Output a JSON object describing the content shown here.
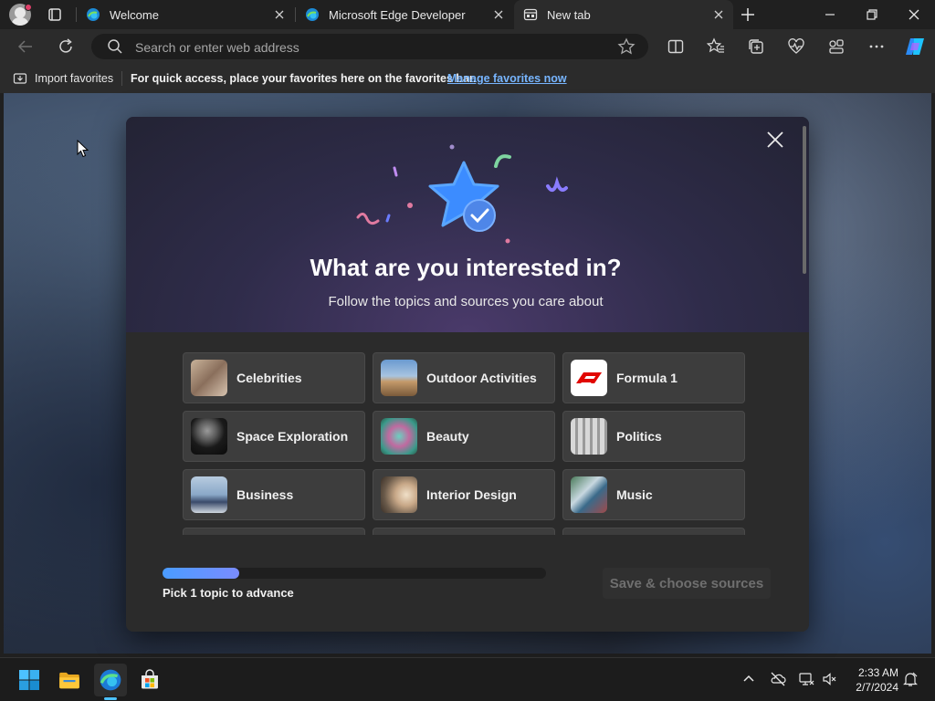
{
  "tabs": [
    {
      "label": "Welcome",
      "active": false
    },
    {
      "label": "Microsoft Edge Developer",
      "active": false
    },
    {
      "label": "New tab",
      "active": true
    }
  ],
  "address": {
    "placeholder": "Search or enter web address"
  },
  "favorites_bar": {
    "import_label": "Import favorites",
    "message": "For quick access, place your favorites here on the favorites bar.",
    "link": "Manage favorites now"
  },
  "modal": {
    "title": "What are you interested in?",
    "subtitle": "Follow the topics and sources you care about",
    "topics": [
      {
        "label": "Celebrities",
        "thumb": "celebrities"
      },
      {
        "label": "Outdoor Activities",
        "thumb": "outdoor"
      },
      {
        "label": "Formula 1",
        "thumb": "f1"
      },
      {
        "label": "Space Exploration",
        "thumb": "space"
      },
      {
        "label": "Beauty",
        "thumb": "beauty"
      },
      {
        "label": "Politics",
        "thumb": "politics"
      },
      {
        "label": "Business",
        "thumb": "business"
      },
      {
        "label": "Interior Design",
        "thumb": "interior"
      },
      {
        "label": "Music",
        "thumb": "music"
      }
    ],
    "progress": 0.2,
    "progress_text": "Pick 1 topic to advance",
    "save_label": "Save & choose sources"
  },
  "taskbar": {
    "time": "2:33 AM",
    "date": "2/7/2024"
  },
  "colors": {
    "accent": "#4cc2ff",
    "link": "#77b5ff",
    "progress": "#4a9cff"
  }
}
